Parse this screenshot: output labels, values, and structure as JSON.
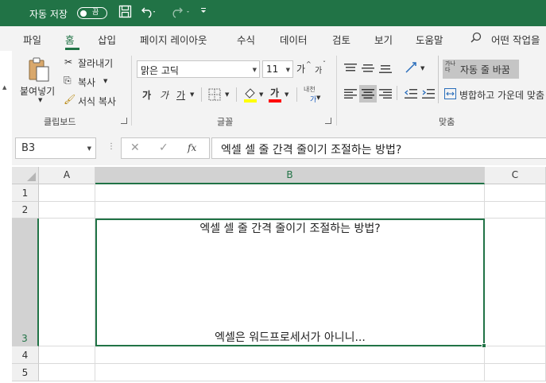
{
  "titlebar": {
    "autosave_label": "자동 저장",
    "autosave_state": "끔",
    "icons": [
      "save-icon",
      "undo-icon",
      "redo-icon",
      "customize-qat-icon"
    ]
  },
  "tabs": [
    "파일",
    "홈",
    "삽입",
    "페이지 레이아웃",
    "수식",
    "데이터",
    "검토",
    "보기",
    "도움말"
  ],
  "active_tab": "홈",
  "search": {
    "text": "어떤 작업을"
  },
  "clipboard": {
    "paste_label": "붙여넣기",
    "cut_label": "잘라내기",
    "copy_label": "복사",
    "format_painter_label": "서식 복사",
    "group_label": "클립보드"
  },
  "font": {
    "font_name": "맑은 고딕",
    "font_size": "11",
    "grow_label": "가",
    "shrink_label": "가",
    "bold_label": "가",
    "italic_label": "가",
    "underline_label": "가",
    "font_color_label": "가",
    "phonetic_label": "내천",
    "phonetic_sub": "가",
    "group_label": "글꼴",
    "fill_color": "#ffff00",
    "font_color": "#ff0000"
  },
  "alignment": {
    "wrap_text_label": "자동 줄 바꿈",
    "wrap_icon_text": "가나다",
    "merge_label": "병합하고 가운데 맞춤",
    "group_label": "맞춤"
  },
  "formula_bar": {
    "name_box": "B3",
    "cancel_symbol": "✕",
    "enter_symbol": "✓",
    "fx_label": "fx",
    "content": "엑셀 셀 줄 간격 줄이기 조절하는 방법?"
  },
  "grid": {
    "columns": [
      "A",
      "B",
      "C"
    ],
    "rows": [
      "1",
      "2",
      "3",
      "4",
      "5"
    ],
    "selected_column": "B",
    "selected_row": "3",
    "cell_b3": {
      "line1": "엑셀 셀 줄 간격 줄이기 조절하는 방법?",
      "line2": "엑셀은 워드프로세서가 아니니..."
    }
  },
  "colors": {
    "accent": "#217346",
    "ribbon_bg": "#f3f3f3",
    "header_bg": "#f0f0f0"
  }
}
